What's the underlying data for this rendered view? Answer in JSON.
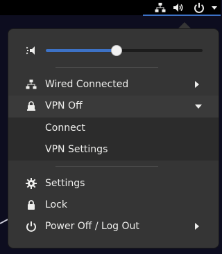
{
  "topbar": {
    "icons": [
      "network-wired-icon",
      "volume-icon",
      "power-icon",
      "dropdown-arrow-icon"
    ]
  },
  "volume": {
    "icon": "volume-low-icon",
    "level": 0.45,
    "accent": "#3d72c6"
  },
  "menu": {
    "items": [
      {
        "label": "Wired Connected",
        "icon": "network-wired-icon",
        "submenu": true
      },
      {
        "label": "VPN Off",
        "icon": "vpn-icon",
        "expanded": true
      },
      {
        "label": "Connect"
      },
      {
        "label": "VPN Settings"
      },
      {
        "label": "Settings",
        "icon": "gear-icon"
      },
      {
        "label": "Lock",
        "icon": "lock-icon"
      },
      {
        "label": "Power Off / Log Out",
        "icon": "power-icon",
        "submenu": true
      }
    ]
  },
  "colors": {
    "menu_bg": "#353535",
    "accent": "#3d72c6",
    "text": "#eeeeec"
  }
}
